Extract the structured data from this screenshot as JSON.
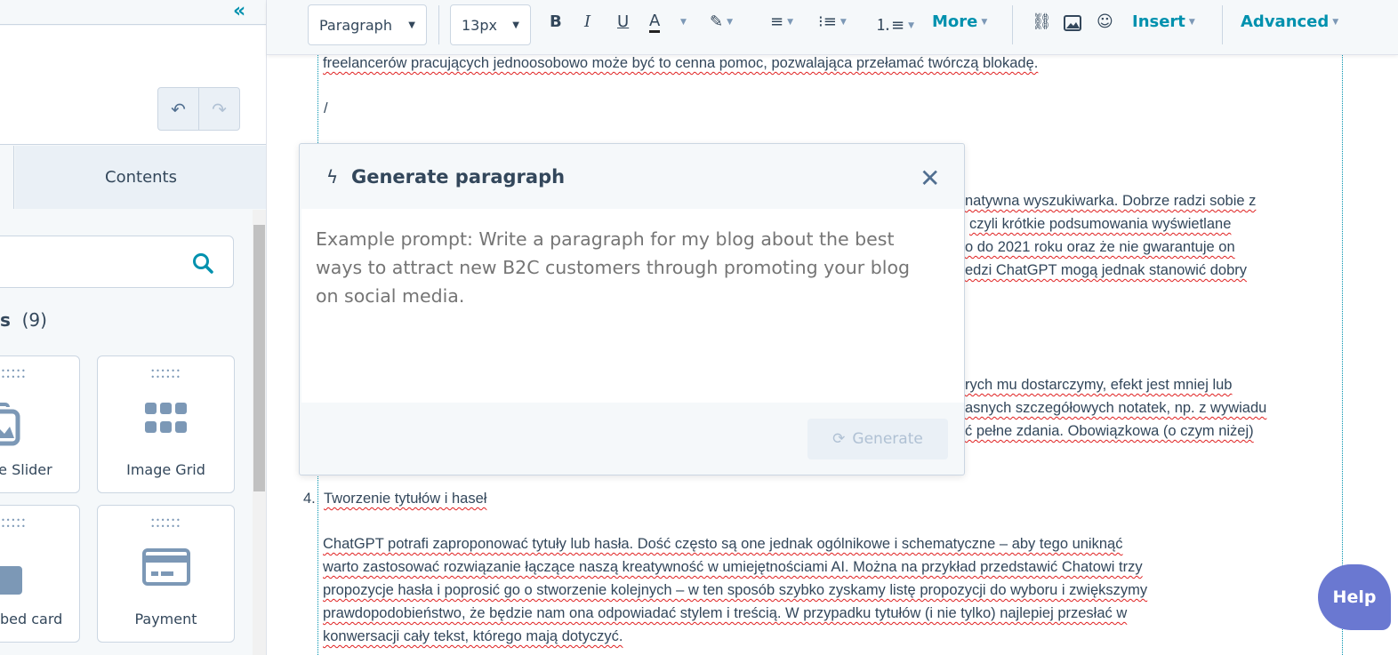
{
  "left_panel": {
    "collapse_icon": "double-chevron-left",
    "undo_icon": "undo",
    "redo_icon": "redo",
    "tab": "Contents",
    "search_placeholder": "",
    "section_title": "s",
    "section_count": "(9)",
    "cards": [
      {
        "label": "ge Slider",
        "icon": "image-slider"
      },
      {
        "label": "Image Grid",
        "icon": "grid"
      },
      {
        "label": "bed card",
        "icon": "folder"
      },
      {
        "label": "Payment",
        "icon": "credit-card"
      }
    ]
  },
  "toolbar": {
    "block_style": "Paragraph",
    "font_size": "13px",
    "more": "More",
    "insert": "Insert",
    "advanced": "Advanced",
    "text_color": "#33475b",
    "accent": "#0091ae"
  },
  "editor": {
    "line1": "freelancerów pracujących jednoosobowo może być to cenna pomoc, pozwalająca przełamać twórczą blokadę.",
    "slash": "/",
    "frag": [
      "natywna wyszukiwarka. Dobrze radzi sobie z",
      "czyli krótkie podsumowania wyświetlane",
      "o do 2021 roku oraz że nie gwarantuje on",
      "edzi ChatGPT mogą jednak stanowić dobry",
      "rych mu dostarczymy, efekt jest mniej lub",
      "asnych szczegółowych notatek, np. z wywiadu",
      "ć pełne zdania. Obowiązkowa (o czym niżej)"
    ],
    "list_num": "4.",
    "heading": "Tworzenie tytułów i haseł",
    "para": [
      "ChatGPT potrafi zaproponować tytuły lub hasła. Dość często są one jednak ogólnikowe i schematyczne – aby tego uniknąć",
      "warto zastosować rozwiązanie łączące naszą kreatywność w umiejętnościami AI. Można na przykład przedstawić Chatowi trzy",
      "propozycje hasła i poprosić go o stworzenie kolejnych – w ten sposób szybko zyskamy listę propozycji do wyboru i zwiększymy",
      "prawdopodobieństwo, że będzie nam ona odpowiadać stylem i treścią. W przypadku tytułów (i nie tylko) najlepiej przesłać w",
      "konwersacji cały tekst, którego mają dotyczyć."
    ]
  },
  "dialog": {
    "title": "Generate paragraph",
    "placeholder": "Example prompt: Write a paragraph for my blog about the best ways to attract new B2C customers through promoting your blog on social media.",
    "generate": "Generate"
  },
  "help": "Help"
}
